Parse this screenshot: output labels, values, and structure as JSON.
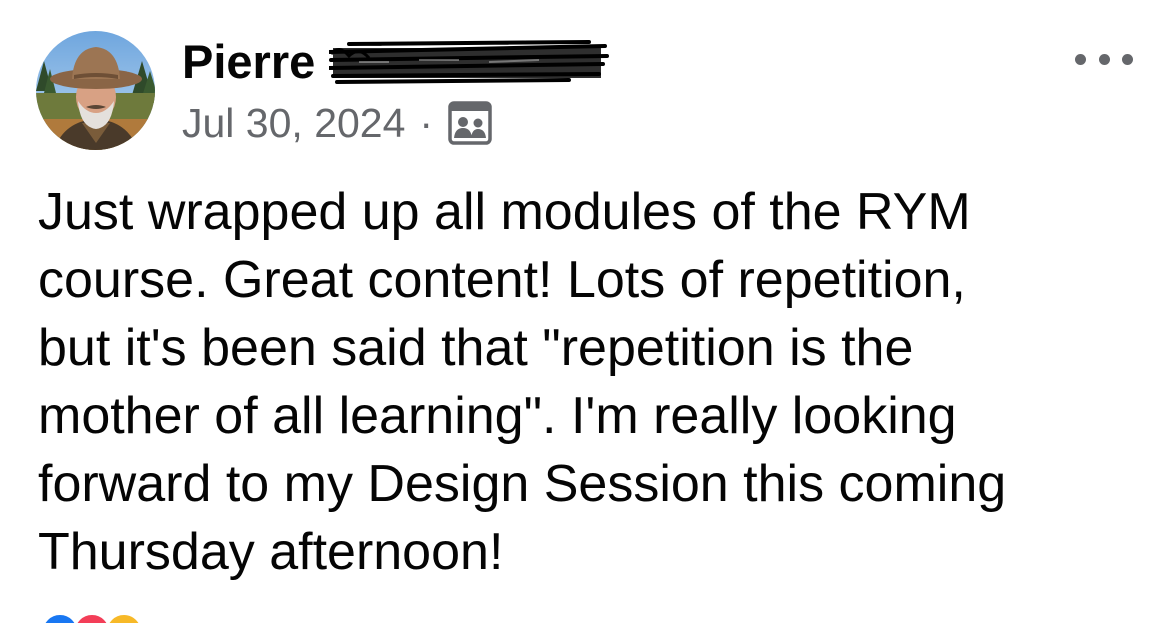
{
  "post": {
    "author_name": "Pierre",
    "date": "Jul 30, 2024",
    "separator": "·",
    "audience_icon": "friends-icon",
    "more_icon": "more-options-icon",
    "body_lines": [
      "Just wrapped up all modules of the RYM",
      "course.  Great content!  Lots of repetition,",
      "but it's been said that \"repetition is the",
      "mother of all learning\".  I'm really looking",
      "forward to my Design Session this coming",
      "Thursday afternoon!"
    ]
  },
  "reactions": [
    {
      "icon": "like-icon",
      "color": "#1877f2"
    },
    {
      "icon": "love-icon",
      "color": "#f33e58"
    },
    {
      "icon": "haha-icon",
      "color": "#f7b928"
    }
  ]
}
